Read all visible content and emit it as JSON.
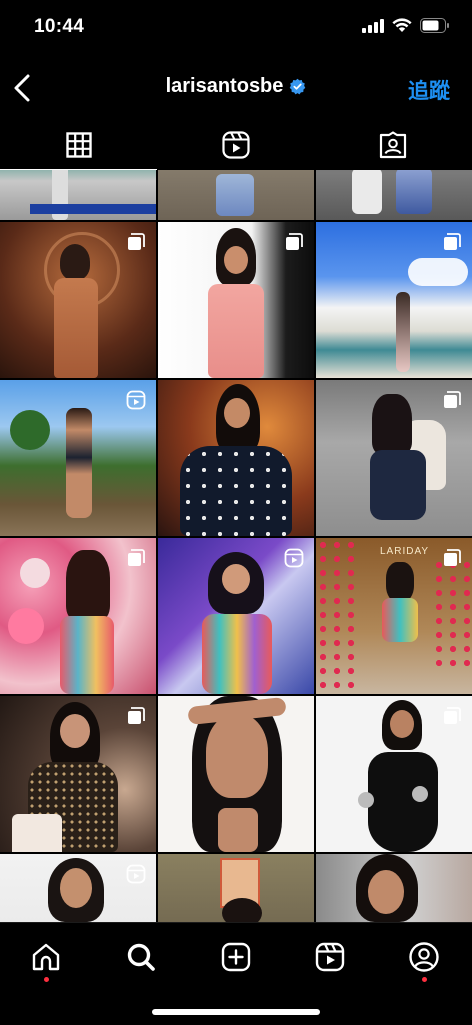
{
  "status_bar": {
    "time": "10:44"
  },
  "header": {
    "username": "larisantosbe",
    "follow_label": "追蹤"
  },
  "tabs": [
    {
      "name": "posts-grid"
    },
    {
      "name": "reels"
    },
    {
      "name": "tagged"
    }
  ],
  "grid": {
    "overlays": [
      {
        "cell_label": "LARIDAY"
      }
    ]
  },
  "colors": {
    "background": "#000000",
    "accent": "#1d8ff2",
    "notification_dot": "#ff3040"
  },
  "icons": {
    "verified": "verified-badge-icon",
    "multi_post": "carousel-icon",
    "reel": "reel-icon"
  }
}
